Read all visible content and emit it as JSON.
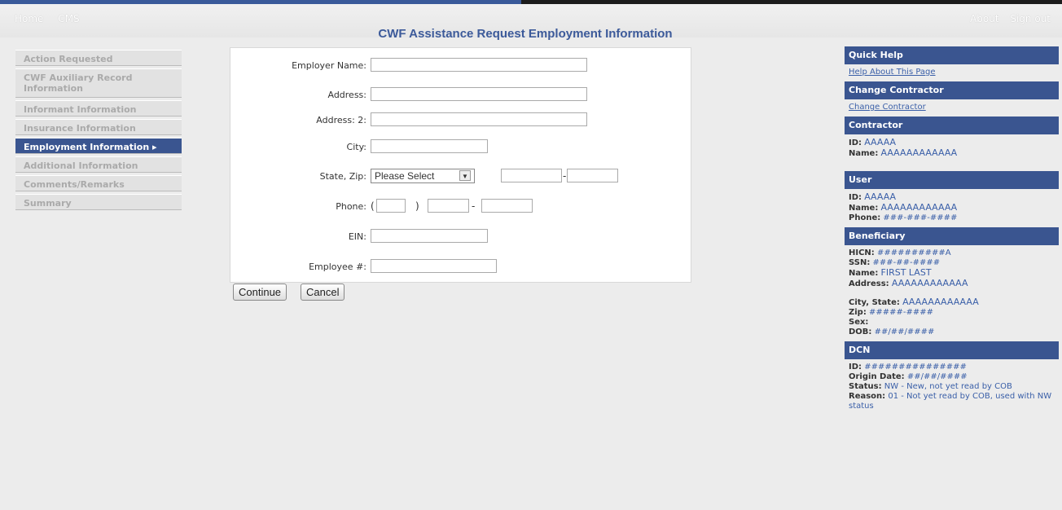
{
  "topnav": {
    "home": "Home",
    "cms": "CMS",
    "about": "About",
    "signout": "Sign out"
  },
  "page": {
    "title": "CWF Assistance Request Employment Information"
  },
  "leftnav": [
    {
      "label": "Action Requested"
    },
    {
      "label": "CWF Auxiliary Record Information"
    },
    {
      "label": "Informant Information"
    },
    {
      "label": "Insurance Information"
    },
    {
      "label": "Employment Information ▸"
    },
    {
      "label": "Additional Information"
    },
    {
      "label": "Comments/Remarks"
    },
    {
      "label": "Summary"
    }
  ],
  "form": {
    "employer_name": {
      "label": "Employer Name:",
      "value": ""
    },
    "address": {
      "label": "Address:",
      "value": ""
    },
    "address2": {
      "label": "Address: 2:",
      "value": ""
    },
    "city": {
      "label": "City:",
      "value": ""
    },
    "state_zip": {
      "label": "State, Zip:",
      "state": "Please Select",
      "zip": "",
      "zip4": "",
      "dash": "-"
    },
    "phone": {
      "label": "Phone:",
      "open": "(",
      "close": ")",
      "dash": "-"
    },
    "ein": {
      "label": "EIN:",
      "value": ""
    },
    "employee_no": {
      "label": "Employee #:",
      "value": ""
    }
  },
  "buttons": {
    "continue": "Continue",
    "cancel": "Cancel"
  },
  "sidebar": {
    "quick_help": {
      "title": "Quick Help",
      "link": "Help About This Page"
    },
    "change_contractor": {
      "title": "Change Contractor",
      "link": "Change Contractor"
    },
    "contractor": {
      "title": "Contractor",
      "id_label": "ID:",
      "id": "AAAAA",
      "name_label": "Name:",
      "name": "AAAAAAAAAAAA"
    },
    "user": {
      "title": "User",
      "id_label": "ID:",
      "id": "AAAAA",
      "name_label": "Name:",
      "name": "AAAAAAAAAAAA",
      "phone_label": "Phone:",
      "phone": "###-###-####"
    },
    "beneficiary": {
      "title": "Beneficiary",
      "hicn_label": "HICN:",
      "hicn": "##########A",
      "ssn_label": "SSN:",
      "ssn": "###-##-####",
      "name_label": "Name:",
      "name": "FIRST LAST",
      "address_label": "Address:",
      "address": "AAAAAAAAAAAA",
      "citystate_label": "City, State:",
      "citystate": "AAAAAAAAAAAA",
      "zip_label": "Zip:",
      "zip": "#####-####",
      "sex_label": "Sex:",
      "sex": "",
      "dob_label": "DOB:",
      "dob": "##/##/####"
    },
    "dcn": {
      "title": "DCN",
      "id_label": "ID:",
      "id": "###############",
      "origin_label": "Origin Date:",
      "origin": "##/##/####",
      "status_label": "Status:",
      "status": "NW - New, not yet read by COB",
      "reason_label": "Reason:",
      "reason": "01 - Not yet read by COB, used with NW status"
    }
  }
}
